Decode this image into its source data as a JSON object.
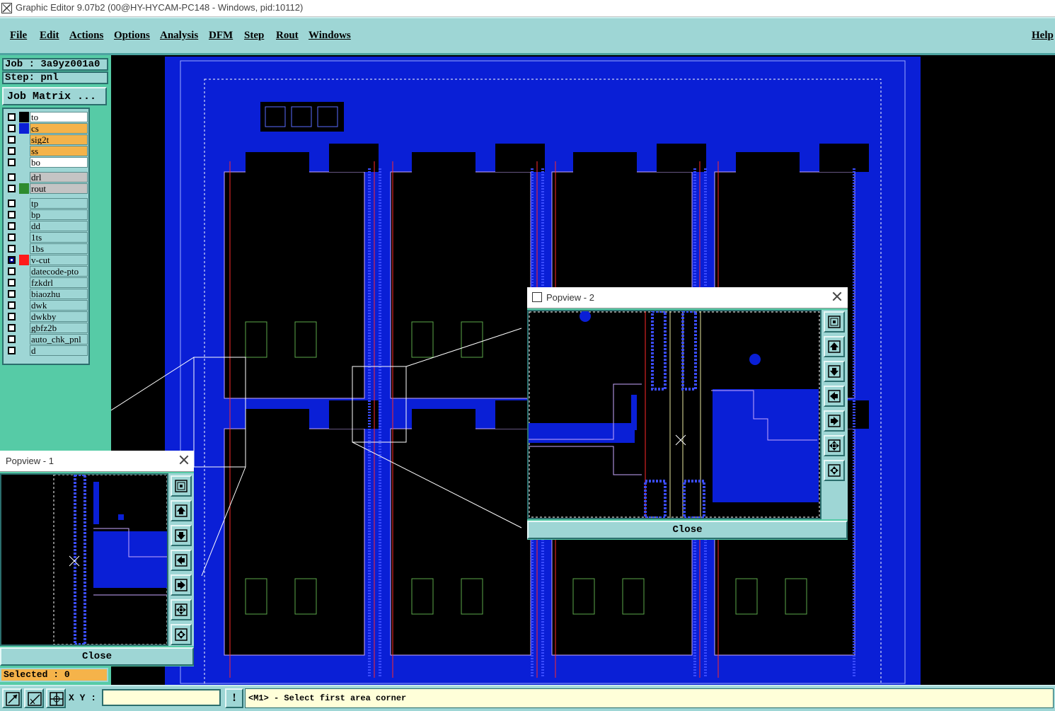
{
  "window": {
    "title": "Graphic Editor 9.07b2 (00@HY-HYCAM-PC148 - Windows, pid:10112)"
  },
  "menu": {
    "items": [
      "File",
      "Edit",
      "Actions",
      "Options",
      "Analysis",
      "DFM",
      "Step",
      "Rout",
      "Windows"
    ],
    "help": "Help"
  },
  "job": {
    "label": "Job : 3a9yz001a0",
    "step": "Step: pnl",
    "matrix_button": "Job Matrix ..."
  },
  "layers": [
    {
      "name": "to",
      "bg": "#ffffff",
      "swatch": "#000000",
      "checked": false,
      "group": 0
    },
    {
      "name": "cs",
      "bg": "#f5b34a",
      "swatch": "#0a1fd6",
      "checked": false,
      "group": 0
    },
    {
      "name": "sig2t",
      "bg": "#f5b34a",
      "swatch": "",
      "checked": false,
      "group": 0
    },
    {
      "name": "ss",
      "bg": "#f5b34a",
      "swatch": "",
      "checked": false,
      "group": 0
    },
    {
      "name": "bo",
      "bg": "#ffffff",
      "swatch": "",
      "checked": false,
      "group": 0
    },
    {
      "name": "drl",
      "bg": "#c4c4c4",
      "swatch": "",
      "checked": false,
      "group": 1
    },
    {
      "name": "rout",
      "bg": "#c4c4c4",
      "swatch": "#2e8b2e",
      "checked": false,
      "group": 1,
      "mark": true
    },
    {
      "name": "tp",
      "bg": "#9ed6d5",
      "swatch": "",
      "checked": false,
      "group": 2
    },
    {
      "name": "bp",
      "bg": "#9ed6d5",
      "swatch": "",
      "checked": false,
      "group": 2
    },
    {
      "name": "dd",
      "bg": "#9ed6d5",
      "swatch": "",
      "checked": false,
      "group": 2
    },
    {
      "name": "1ts",
      "bg": "#9ed6d5",
      "swatch": "",
      "checked": false,
      "group": 2
    },
    {
      "name": "1bs",
      "bg": "#9ed6d5",
      "swatch": "",
      "checked": false,
      "group": 2
    },
    {
      "name": "v-cut",
      "bg": "#9ed6d5",
      "swatch": "#ff1a1a",
      "checked": true,
      "group": 2
    },
    {
      "name": "datecode-pto",
      "bg": "#9ed6d5",
      "swatch": "",
      "checked": false,
      "group": 2
    },
    {
      "name": "fzkdrl",
      "bg": "#9ed6d5",
      "swatch": "",
      "checked": false,
      "group": 2
    },
    {
      "name": "biaozhu",
      "bg": "#9ed6d5",
      "swatch": "",
      "checked": false,
      "group": 2
    },
    {
      "name": "dwk",
      "bg": "#9ed6d5",
      "swatch": "",
      "checked": false,
      "group": 2
    },
    {
      "name": "dwkby",
      "bg": "#9ed6d5",
      "swatch": "",
      "checked": false,
      "group": 2
    },
    {
      "name": "gbfz2b",
      "bg": "#9ed6d5",
      "swatch": "",
      "checked": false,
      "group": 2
    },
    {
      "name": "auto_chk_pnl",
      "bg": "#9ed6d5",
      "swatch": "",
      "checked": false,
      "group": 2
    },
    {
      "name": "d",
      "bg": "#9ed6d5",
      "swatch": "",
      "checked": false,
      "group": 2
    }
  ],
  "popview1": {
    "title": "Popview - 1",
    "close_label": "Close",
    "tools": [
      "zoom-window-icon",
      "pan-up-icon",
      "pan-down-icon",
      "pan-left-icon",
      "pan-right-icon",
      "zoom-in-icon",
      "zoom-out-icon"
    ]
  },
  "popview2": {
    "title": "Popview - 2",
    "close_label": "Close",
    "tools": [
      "zoom-window-icon",
      "pan-up-icon",
      "pan-down-icon",
      "pan-left-icon",
      "pan-right-icon",
      "zoom-in-icon",
      "zoom-out-icon"
    ]
  },
  "status": {
    "selected": "Selected : 0",
    "xy_label": "X Y :",
    "xy_value": "",
    "warn": "!",
    "prompt": "<M1> - Select first area corner"
  },
  "colors": {
    "board": "#0a1fd6",
    "panel": "#56cba6",
    "widget": "#9ed6d5",
    "menubar": "#9ed6d5",
    "highlight": "#f5b34a"
  }
}
